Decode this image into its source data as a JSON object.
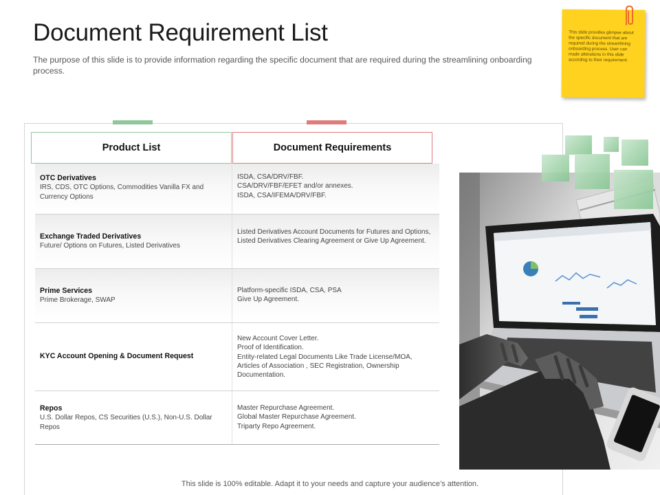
{
  "slide": {
    "title": "Document Requirement List",
    "subtitle": "The purpose of this slide is to provide information regarding the specific document that are required during the streamlining onboarding process.",
    "sticky_note": "This slide provides glimpse about the specific document that are required during the streamlining onboarding process. User can made alterations in this slide according to their requirement.",
    "footer": "This slide is 100% editable. Adapt it to your needs and capture your audience’s attention."
  },
  "table": {
    "headers": {
      "product": "Product List",
      "documents": "Document Requirements"
    },
    "rows": [
      {
        "title": "OTC Derivatives",
        "detail": "IRS, CDS, OTC Options, Commodities Vanilla FX and Currency Options",
        "docs": [
          "ISDA, CSA/DRV/FBF.",
          "CSA/DRV/FBF/EFET and/or annexes.",
          "ISDA, CSA/IFEMA/DRV/FBF."
        ]
      },
      {
        "title": "Exchange Traded Derivatives",
        "detail": "Future/ Options on Futures, Listed Derivatives",
        "docs": [
          "Listed Derivatives Account Documents for Futures and Options, Listed Derivatives Clearing Agreement or Give Up Agreement."
        ]
      },
      {
        "title": "Prime Services",
        "detail": "Prime Brokerage, SWAP",
        "docs": [
          "Platform-specific ISDA, CSA, PSA",
          "Give Up Agreement."
        ]
      },
      {
        "title": "KYC Account Opening & Document Request",
        "detail": "",
        "docs": [
          "New Account Cover Letter.",
          "Proof of Identification.",
          "Entity-related Legal Documents Like Trade License/MOA, Articles of Association , SEC Registration, Ownership Documentation."
        ]
      },
      {
        "title": "Repos",
        "detail": "U.S. Dollar Repos, CS Securities (U.S.), Non-U.S. Dollar Repos",
        "docs": [
          "Master Repurchase Agreement.",
          "Global Master Repurchase Agreement.",
          "Triparty Repo Agreement."
        ]
      }
    ]
  },
  "colors": {
    "green_accent": "#8fc79b",
    "red_accent": "#e07b7b",
    "sticky_yellow": "#ffd21f"
  }
}
